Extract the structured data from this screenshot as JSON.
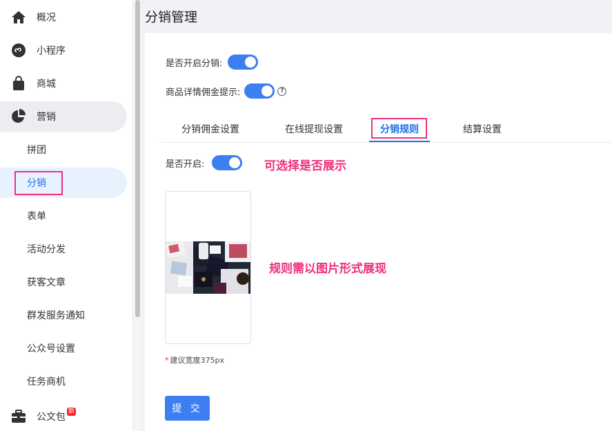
{
  "sidebar": {
    "items": [
      {
        "label": "概况",
        "icon": "home-icon"
      },
      {
        "label": "小程序",
        "icon": "mini-program-icon"
      },
      {
        "label": "商城",
        "icon": "shopping-bag-icon"
      },
      {
        "label": "营销",
        "icon": "pie-chart-icon"
      }
    ],
    "sub_items": [
      "拼团",
      "分销",
      "表单",
      "活动分发",
      "获客文章",
      "群发服务通知",
      "公众号设置",
      "任务商机"
    ],
    "bottom_item": {
      "label": "公文包",
      "badge": "新",
      "icon": "briefcase-icon"
    }
  },
  "page": {
    "title": "分销管理"
  },
  "form": {
    "enable_distribution_label": "是否开启分销:",
    "commission_hint_label": "商品详情佣金提示:",
    "enable_label": "是否开启:"
  },
  "tabs": [
    "分销佣金设置",
    "在线提现设置",
    "分销规则",
    "结算设置"
  ],
  "active_tab": "分销规则",
  "annotations": {
    "toggle_note": "可选择是否展示",
    "image_note": "规则需以图片形式展现"
  },
  "upload": {
    "hint": "建议宽度375px"
  },
  "submit_label": "提 交",
  "colors": {
    "primary": "#3d7ef0",
    "highlight": "#ee2f7a",
    "selected_bg": "#e8f2ff"
  }
}
